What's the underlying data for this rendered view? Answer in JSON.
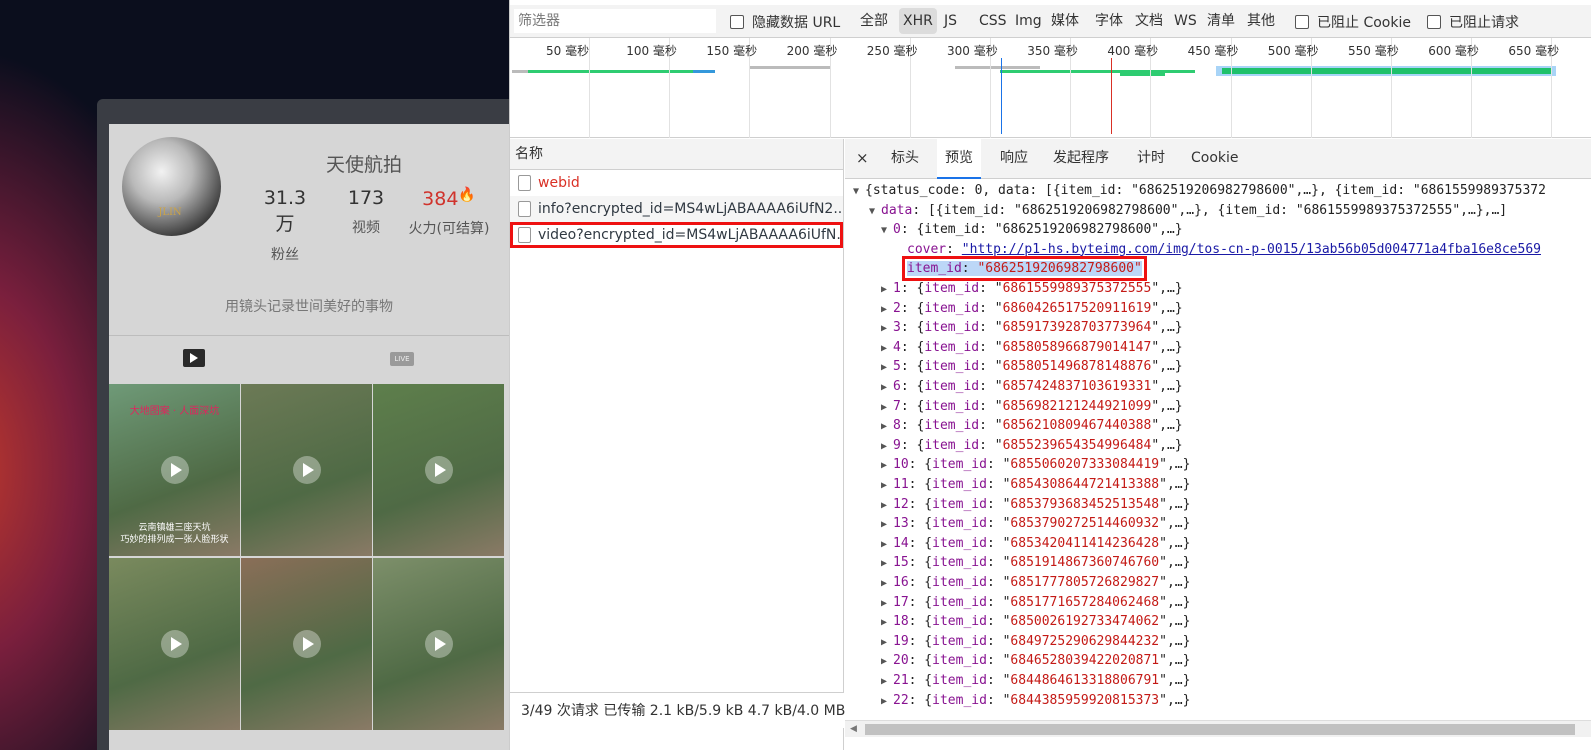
{
  "profile": {
    "name": "天使航拍",
    "avatar_logo": "JLIN",
    "stats": [
      {
        "value": "31.3万",
        "label": "粉丝"
      },
      {
        "value": "173",
        "label": "视频"
      },
      {
        "value": "384",
        "label": "火力(可结算)"
      }
    ],
    "fire_icon": "🔥",
    "bio": "用镜头记录世间美好的事物",
    "tabs": {
      "video_icon": "video-tab-icon",
      "live_icon_text": "LIVE"
    },
    "thumbs": [
      {
        "color": "#6f9a78",
        "caption_top": "大地图案 · 人面深坑",
        "caption_bottom": "云南镇雄三座天坑\n巧妙的排列成一张人脸形状"
      },
      {
        "color": "#6c7a56",
        "caption_top": "",
        "caption_bottom": ""
      },
      {
        "color": "#5e7f4c",
        "caption_top": "",
        "caption_bottom": ""
      },
      {
        "color": "#7a8a5e",
        "caption_top": "",
        "caption_bottom": ""
      },
      {
        "color": "#8a6e58",
        "caption_top": "",
        "caption_bottom": ""
      },
      {
        "color": "#7d8f6a",
        "caption_top": "",
        "caption_bottom": ""
      }
    ]
  },
  "devtools": {
    "filter_placeholder": "筛选器",
    "hide_data_url": "隐藏数据 URL",
    "types": [
      "全部",
      "XHR",
      "JS",
      "CSS",
      "Img",
      "媒体",
      "字体",
      "文档",
      "WS",
      "清单",
      "其他"
    ],
    "active_type": "XHR",
    "blocked_cookie": "已阻止 Cookie",
    "blocked_requests": "已阻止请求",
    "timeline_ticks": [
      "50 毫秒",
      "100 毫秒",
      "150 毫秒",
      "200 毫秒",
      "250 毫秒",
      "300 毫秒",
      "350 毫秒",
      "400 毫秒",
      "450 毫秒",
      "500 毫秒",
      "550 毫秒",
      "600 毫秒",
      "650 毫秒"
    ],
    "name_header": "名称",
    "requests": [
      {
        "name": "webid",
        "status": "error"
      },
      {
        "name": "info?encrypted_id=MS4wLjABAAAA6iUfN2...",
        "status": "ok"
      },
      {
        "name": "video?encrypted_id=MS4wLjABAAAA6iUfN...",
        "status": "selected"
      }
    ],
    "status_bar": "3/49 次请求  已传输 2.1 kB/5.9 kB  4.7 kB/4.0 MB",
    "detail_tabs": [
      "标头",
      "预览",
      "响应",
      "发起程序",
      "计时",
      "Cookie"
    ],
    "active_detail_tab": "预览",
    "close_glyph": "×",
    "preview": {
      "root": "{status_code: 0, data: [{item_id: \"6862519206982798600\",…}, {item_id: \"6861559989375372",
      "data_line_key": "data",
      "data_line_rest": ": [{item_id: \"6862519206982798600\",…}, {item_id: \"6861559989375372555\",…},…]",
      "item0_key": "0",
      "item0_rest": ": {item_id: \"6862519206982798600\",…}",
      "cover_key": "cover",
      "cover_url": "\"http://p1-hs.byteimg.com/img/tos-cn-p-0015/13ab56b05d004771a4fba16e8ce569",
      "selected_key": "item_id",
      "selected_value": "\"6862519206982798600\"",
      "items": [
        {
          "idx": "1",
          "id": "6861559989375372555"
        },
        {
          "idx": "2",
          "id": "6860426517520911619"
        },
        {
          "idx": "3",
          "id": "6859173928703773964"
        },
        {
          "idx": "4",
          "id": "6858058966879014147"
        },
        {
          "idx": "5",
          "id": "6858051496878148876"
        },
        {
          "idx": "6",
          "id": "6857424837103619331"
        },
        {
          "idx": "7",
          "id": "6856982121244921099"
        },
        {
          "idx": "8",
          "id": "6856210809467440388"
        },
        {
          "idx": "9",
          "id": "6855239654354996484"
        },
        {
          "idx": "10",
          "id": "6855060207333084419"
        },
        {
          "idx": "11",
          "id": "6854308644721413388"
        },
        {
          "idx": "12",
          "id": "6853793683452513548"
        },
        {
          "idx": "13",
          "id": "6853790272514460932"
        },
        {
          "idx": "14",
          "id": "6853420411414236428"
        },
        {
          "idx": "15",
          "id": "6851914867360746760"
        },
        {
          "idx": "16",
          "id": "6851777805726829827"
        },
        {
          "idx": "17",
          "id": "6851771657284062468"
        },
        {
          "idx": "18",
          "id": "6850026192733474062"
        },
        {
          "idx": "19",
          "id": "6849725290629844232"
        },
        {
          "idx": "20",
          "id": "6846528039422020871"
        },
        {
          "idx": "21",
          "id": "6844864613318806791"
        },
        {
          "idx": "22",
          "id": "6844385959920815373"
        }
      ]
    }
  }
}
